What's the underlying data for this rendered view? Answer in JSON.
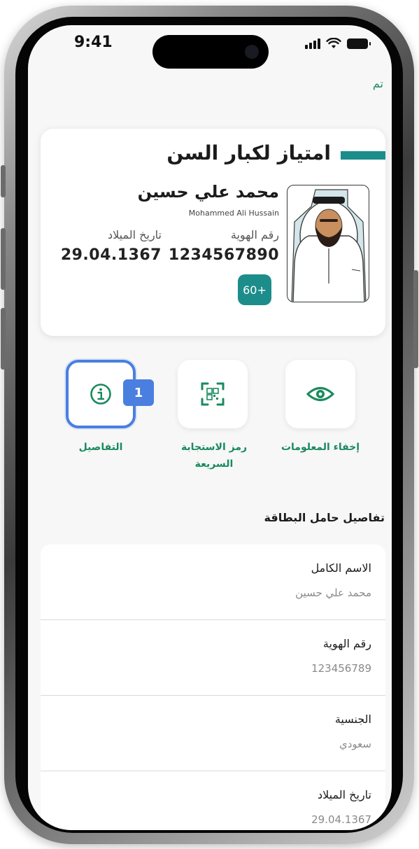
{
  "status_bar": {
    "time": "9:41"
  },
  "header": {
    "done_label": "تم"
  },
  "card": {
    "title": "امتياز لكبار السن",
    "name_ar": "محمد علي حسين",
    "name_en": "Mohammed Ali Hussain",
    "id_label": "رقم الهوية",
    "id_value": "1234567890",
    "dob_label": "تاريخ الميلاد",
    "dob_value": "29.04.1367",
    "age_badge": "60+",
    "accent_color": "#1c8d8a"
  },
  "actions": [
    {
      "label": "إخفاء المعلومات",
      "icon": "eye-icon"
    },
    {
      "label_line1": "رمز الاستجابة",
      "label_line2": "السريعة",
      "icon": "qr-code-icon"
    },
    {
      "label": "التفاصيل",
      "icon": "info-icon"
    }
  ],
  "annotation": {
    "step_number": "1",
    "color": "#4a7fe0"
  },
  "details": {
    "section_title": "تفاصيل حامل البطاقة",
    "rows": [
      {
        "label": "الاسم الكامل",
        "value": "محمد علي حسين"
      },
      {
        "label": "رقم الهوية",
        "value": "123456789"
      },
      {
        "label": "الجنسية",
        "value": "سعودي"
      },
      {
        "label": "تاريخ الميلاد",
        "value": "29.04.1367"
      }
    ]
  },
  "theme": {
    "primary_green": "#1a8a5e",
    "teal": "#1c8d8a"
  }
}
